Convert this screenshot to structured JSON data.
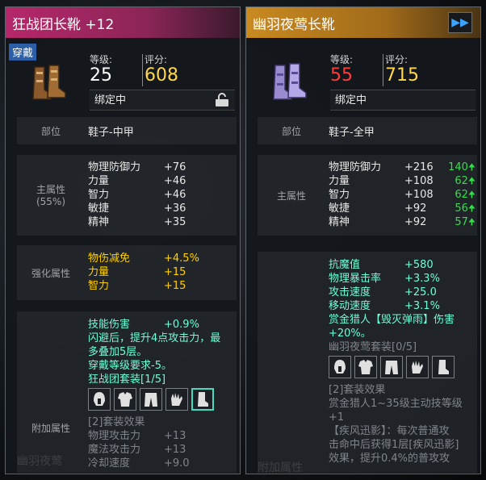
{
  "left": {
    "title": "狂战团长靴 +12",
    "equipped_tag": "穿戴",
    "level_label": "等级:",
    "level_value": "25",
    "score_label": "评分:",
    "score_value": "608",
    "bind_text": "绑定中",
    "slot_label": "部位",
    "slot_value": "鞋子-中甲",
    "main_attr_label": "主属性",
    "main_attr_pct": "(55%)",
    "main_stats": [
      {
        "name": "物理防御力",
        "value": "+76"
      },
      {
        "name": "力量",
        "value": "+46"
      },
      {
        "name": "智力",
        "value": "+46"
      },
      {
        "name": "敏捷",
        "value": "+36"
      },
      {
        "name": "精神",
        "value": "+35"
      }
    ],
    "enh_label": "强化属性",
    "enh_stats": [
      {
        "name": "物伤减免",
        "value": "+4.5%"
      },
      {
        "name": "力量",
        "value": "+15"
      },
      {
        "name": "智力",
        "value": "+15"
      }
    ],
    "extra_label": "附加属性",
    "extra_stat": {
      "name": "技能伤害",
      "value": "+0.9%"
    },
    "extra_desc1": "闪避后，提升4点攻击力，最",
    "extra_desc2": "多叠加5层。",
    "extra_desc3": "穿戴等级要求-5。",
    "set_name": "狂战团套装[1/5]",
    "set_effect_title": "[2]套装效果",
    "set_effects": [
      {
        "name": "物理攻击力",
        "value": "+13"
      },
      {
        "name": "魔法攻击力",
        "value": "+13"
      },
      {
        "name": "冷却速度",
        "value": "+9.0"
      }
    ],
    "bg_text": "幽羽夜莺"
  },
  "right": {
    "title": "幽羽夜莺长靴",
    "level_label": "等级:",
    "level_value": "55",
    "score_label": "评分:",
    "score_value": "715",
    "bind_text": "绑定中",
    "slot_label": "部位",
    "slot_value": "鞋子-全甲",
    "main_attr_label": "主属性",
    "main_stats": [
      {
        "name": "物理防御力",
        "value": "+216",
        "diff": "140"
      },
      {
        "name": "力量",
        "value": "+108",
        "diff": "62"
      },
      {
        "name": "智力",
        "value": "+108",
        "diff": "62"
      },
      {
        "name": "敏捷",
        "value": "+92",
        "diff": "56"
      },
      {
        "name": "精神",
        "value": "+92",
        "diff": "57"
      }
    ],
    "extra_stats": [
      {
        "name": "抗魔值",
        "value": "+580"
      },
      {
        "name": "物理暴击率",
        "value": "+3.3%"
      },
      {
        "name": "攻击速度",
        "value": "+25.0"
      },
      {
        "name": "移动速度",
        "value": "+3.1%"
      }
    ],
    "bounty_line1": "赏金猎人【毁灭弹雨】伤害",
    "bounty_line2": "+20%。",
    "set_name": "幽羽夜莺套装[0/5]",
    "set_effect_title": "[2]套装效果",
    "set_effect_line1": "赏金猎人1~35级主动技等级",
    "set_effect_line2": "+1",
    "skill_title": "【疾风迅影】：每次普通攻",
    "skill_line2": "击命中后获得1层[疾风迅影]",
    "skill_line3": "效果，提升0.4%的普攻攻",
    "bg_text": "附加属性"
  },
  "colors": {
    "left_title": "#b6276a",
    "right_title": "#c98a20",
    "score": "#ffd84a",
    "diff_up": "#32e04a",
    "set_text": "#6dffd9"
  }
}
